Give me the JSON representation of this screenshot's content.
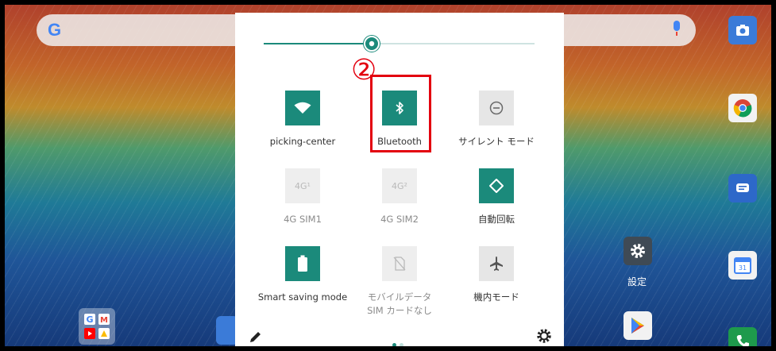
{
  "launcher": {
    "search_logo": "G",
    "settings_label": "設定",
    "icons": [
      "camera-icon",
      "chrome-icon",
      "messages-icon",
      "calendar-icon",
      "phone-icon",
      "play-store-icon",
      "google-folder-icon",
      "settings-icon"
    ]
  },
  "quick_settings": {
    "brightness_percent": 40,
    "callout": "②",
    "tiles": [
      {
        "label": "picking-center",
        "state": "on",
        "icon": "wifi-icon"
      },
      {
        "label": "Bluetooth",
        "state": "on",
        "icon": "bluetooth-icon"
      },
      {
        "label": "サイレント モード",
        "state": "off",
        "icon": "do-not-disturb-icon"
      },
      {
        "label": "4G SIM1",
        "state": "disabled",
        "icon": "4g-sim1-icon",
        "glyph": "4G¹"
      },
      {
        "label": "4G SIM2",
        "state": "disabled",
        "icon": "4g-sim2-icon",
        "glyph": "4G²"
      },
      {
        "label": "自動回転",
        "state": "on",
        "icon": "auto-rotate-icon"
      },
      {
        "label": "Smart saving mode",
        "state": "on",
        "icon": "battery-icon"
      },
      {
        "label": "モバイルデータ",
        "sublabel": "SIM カードなし",
        "state": "disabled",
        "icon": "mobile-data-icon"
      },
      {
        "label": "機内モード",
        "state": "off",
        "icon": "airplane-icon"
      }
    ],
    "page_dots": 2,
    "active_page": 1
  },
  "colors": {
    "accent": "#1b8a7b",
    "highlight": "#e3000f"
  }
}
